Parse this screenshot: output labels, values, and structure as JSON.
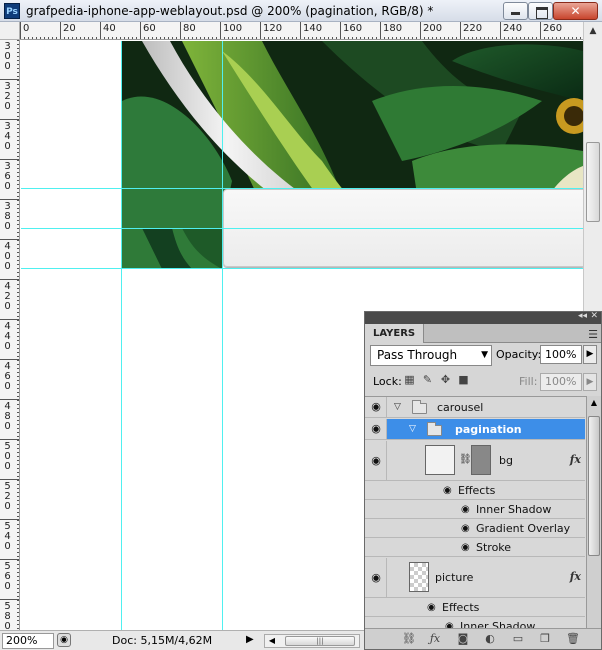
{
  "window": {
    "title": "grafpedia-iphone-app-weblayout.psd @ 200% (pagination, RGB/8) *",
    "app_icon": "Ps"
  },
  "rulers": {
    "horizontal": [
      "0",
      "20",
      "40",
      "60",
      "80",
      "100",
      "120",
      "140",
      "160",
      "180",
      "200",
      "220",
      "240",
      "260"
    ],
    "vertical": [
      "300",
      "320",
      "340",
      "360",
      "380",
      "400",
      "420",
      "440",
      "460",
      "480",
      "500",
      "520",
      "540",
      "560",
      "580"
    ]
  },
  "status": {
    "zoom": "200%",
    "doc_info": "Doc: 5,15M/4,62M",
    "arrow": "▶"
  },
  "layers_panel": {
    "tab_label": "LAYERS",
    "blend_mode": "Pass Through",
    "opacity_label": "Opacity:",
    "opacity_value": "100%",
    "lock_label": "Lock:",
    "fill_label": "Fill:",
    "fill_value": "100%",
    "layers": {
      "carousel": "carousel",
      "pagination": "pagination",
      "bg": "bg",
      "bg_effects_label": "Effects",
      "bg_effects": [
        "Inner Shadow",
        "Gradient Overlay",
        "Stroke"
      ],
      "picture": "picture",
      "picture_effects_label": "Effects",
      "picture_effects": [
        "Inner Shadow"
      ],
      "fx_label": "fx"
    }
  },
  "colors": {
    "guide": "#4ff0f0",
    "selected_layer": "#3d8ee8"
  }
}
